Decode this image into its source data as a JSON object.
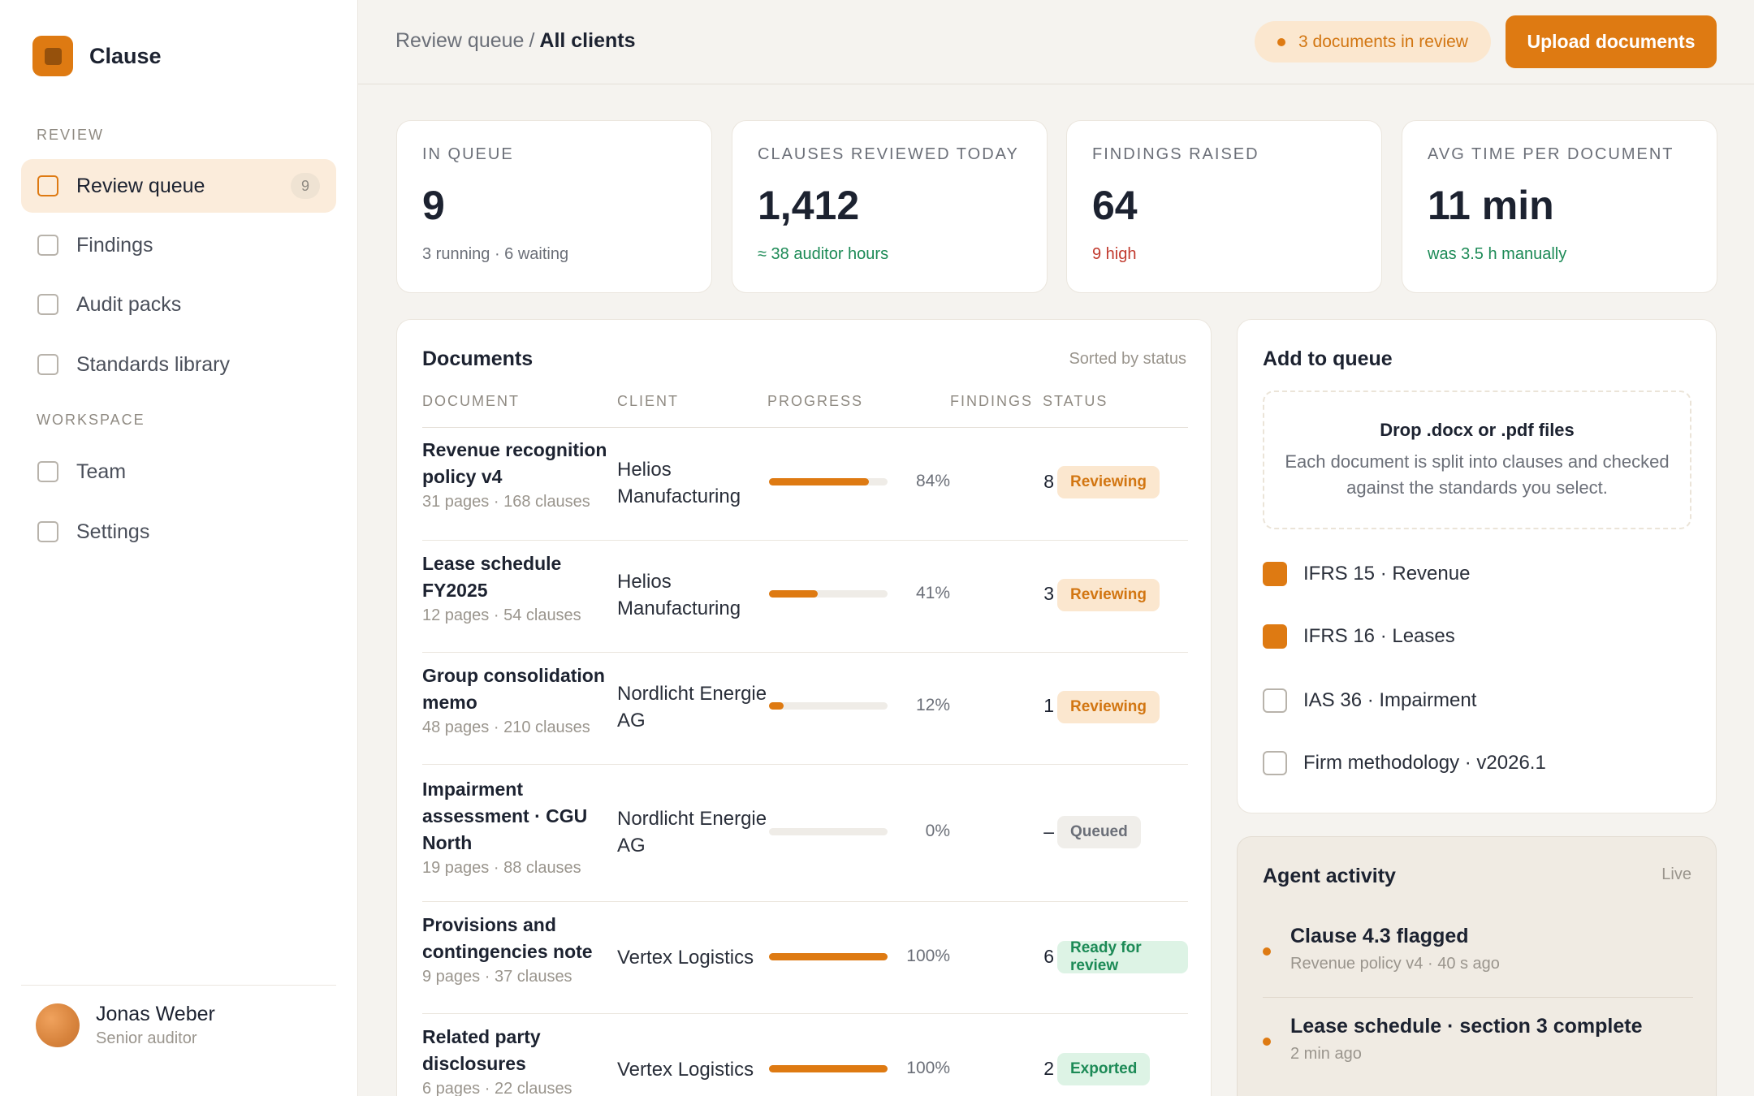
{
  "app": {
    "name": "Clause"
  },
  "sidebar": {
    "review_label": "REVIEW",
    "workspace_label": "WORKSPACE",
    "items": [
      {
        "label": "Review queue",
        "count": "9",
        "active": true
      },
      {
        "label": "Findings"
      },
      {
        "label": "Audit packs"
      },
      {
        "label": "Standards library"
      },
      {
        "label": "Team"
      },
      {
        "label": "Settings"
      }
    ],
    "user": {
      "name": "Jonas Weber",
      "role": "Senior auditor"
    }
  },
  "header": {
    "crumb_parent": "Review queue",
    "crumb_sep": "/",
    "crumb_current": "All clients",
    "pill": "3 documents in review",
    "upload_label": "Upload documents"
  },
  "stats": [
    {
      "label": "IN QUEUE",
      "value": "9",
      "sub": "3 running · 6 waiting"
    },
    {
      "label": "CLAUSES REVIEWED TODAY",
      "value": "1,412",
      "sub": "≈ 38 auditor hours"
    },
    {
      "label": "FINDINGS RAISED",
      "value": "64",
      "sub": "9 high"
    },
    {
      "label": "AVG TIME PER DOCUMENT",
      "value": "11 min",
      "sub": "was 3.5 h manually"
    }
  ],
  "documents": {
    "title": "Documents",
    "sort": "Sorted by status",
    "columns": [
      "DOCUMENT",
      "CLIENT",
      "PROGRESS",
      "FINDINGS",
      "STATUS"
    ],
    "rows": [
      {
        "name": "Revenue recognition policy v4",
        "meta": "31 pages · 168 clauses",
        "client": "Helios Manufacturing",
        "progress": 84,
        "pct": "84%",
        "findings": "8",
        "status": "Reviewing"
      },
      {
        "name": "Lease schedule FY2025",
        "meta": "12 pages · 54 clauses",
        "client": "Helios Manufacturing",
        "progress": 41,
        "pct": "41%",
        "findings": "3",
        "status": "Reviewing"
      },
      {
        "name": "Group consolidation memo",
        "meta": "48 pages · 210 clauses",
        "client": "Nordlicht Energie AG",
        "progress": 12,
        "pct": "12%",
        "findings": "1",
        "status": "Reviewing"
      },
      {
        "name": "Impairment assessment · CGU North",
        "meta": "19 pages · 88 clauses",
        "client": "Nordlicht Energie AG",
        "progress": 0,
        "pct": "0%",
        "findings": "–",
        "status": "Queued"
      },
      {
        "name": "Provisions and contingencies note",
        "meta": "9 pages · 37 clauses",
        "client": "Vertex Logistics",
        "progress": 100,
        "pct": "100%",
        "findings": "6",
        "status": "Ready for review"
      },
      {
        "name": "Related party disclosures",
        "meta": "6 pages · 22 clauses",
        "client": "Vertex Logistics",
        "progress": 100,
        "pct": "100%",
        "findings": "2",
        "status": "Exported"
      }
    ]
  },
  "add_queue": {
    "title": "Add to queue",
    "drop_title": "Drop .docx or .pdf files",
    "drop_desc": "Each document is split into clauses and checked against the standards you select.",
    "standards": [
      {
        "label": "IFRS 15 · Revenue",
        "checked": true
      },
      {
        "label": "IFRS 16 · Leases",
        "checked": true
      },
      {
        "label": "IAS 36 · Impairment",
        "checked": false
      },
      {
        "label": "Firm methodology · v2026.1",
        "checked": false
      }
    ]
  },
  "agent": {
    "title": "Agent activity",
    "live": "Live",
    "items": [
      {
        "title": "Clause 4.3 flagged",
        "meta": "Revenue policy v4 · 40 s ago"
      },
      {
        "title": "Lease schedule · section 3 complete",
        "meta": "2 min ago"
      }
    ]
  },
  "colors": {
    "accent": "#de7a12",
    "green": "#1c8a56",
    "red": "#c13a2e"
  }
}
